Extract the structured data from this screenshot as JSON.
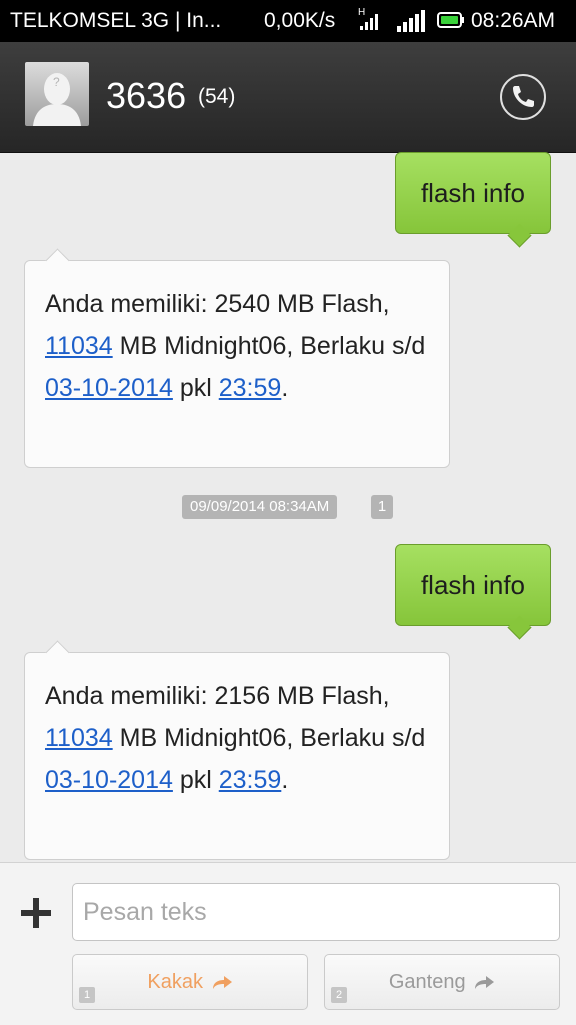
{
  "status_bar": {
    "carrier": "TELKOMSEL 3G | In...",
    "speed": "0,00K/s",
    "network_type": "H",
    "time": "08:26AM"
  },
  "header": {
    "contact": "3636",
    "count": "(54)",
    "call_icon": "phone-icon"
  },
  "messages": [
    {
      "direction": "out",
      "text": "flash info"
    },
    {
      "direction": "in",
      "segments": [
        {
          "t": "Anda memiliki: 2540 MB Flash, ",
          "link": false
        },
        {
          "t": "11034",
          "link": true
        },
        {
          "t": " MB Midnight06, Berlaku s/d ",
          "link": false
        },
        {
          "t": "03-10-2014",
          "link": true
        },
        {
          "t": " pkl ",
          "link": false
        },
        {
          "t": "23:59",
          "link": true
        },
        {
          "t": ".",
          "link": false
        }
      ]
    },
    {
      "direction": "out",
      "text": "flash info"
    },
    {
      "direction": "in",
      "segments": [
        {
          "t": "Anda memiliki: 2156 MB Flash, ",
          "link": false
        },
        {
          "t": "11034",
          "link": true
        },
        {
          "t": " MB Midnight06, Berlaku s/d ",
          "link": false
        },
        {
          "t": "03-10-2014",
          "link": true
        },
        {
          "t": " pkl ",
          "link": false
        },
        {
          "t": "23:59",
          "link": true
        },
        {
          "t": ".",
          "link": false
        }
      ]
    }
  ],
  "timestamp": "09/09/2014 08:34AM",
  "timestamp_sim": "1",
  "compose": {
    "placeholder": "Pesan teks",
    "sim1": {
      "num": "1",
      "label": "Kakak",
      "color": "#f0a060"
    },
    "sim2": {
      "num": "2",
      "label": "Ganteng",
      "color": "#9a9a9a"
    }
  },
  "colors": {
    "outgoing_bubble": "#94d14a",
    "link": "#1d5fc9",
    "header_bg": "#2e2e2e"
  }
}
